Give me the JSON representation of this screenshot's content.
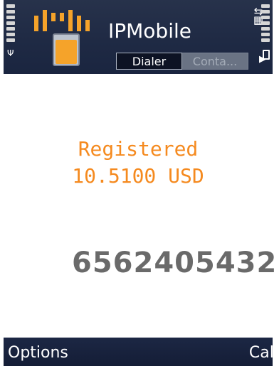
{
  "app": {
    "title": "IPMobile",
    "tabs": [
      {
        "label": "Dialer",
        "active": true
      },
      {
        "label": "Conta...",
        "active": false
      }
    ],
    "colors": {
      "header_bg": "#1f2a44",
      "accent_orange": "#f58a1f",
      "number_gray": "#6a6a6a",
      "softkey_bg": "#1c2744"
    }
  },
  "status_bar": {
    "signal_icon": "signal-strength-icon",
    "battery_icon": "battery-icon",
    "network_icon": "network-activity-icon"
  },
  "main": {
    "registration_status": "Registered",
    "balance": "10.5100  USD",
    "dialed_number": "6562405432"
  },
  "softkeys": {
    "left": "Options",
    "right": "Call"
  }
}
